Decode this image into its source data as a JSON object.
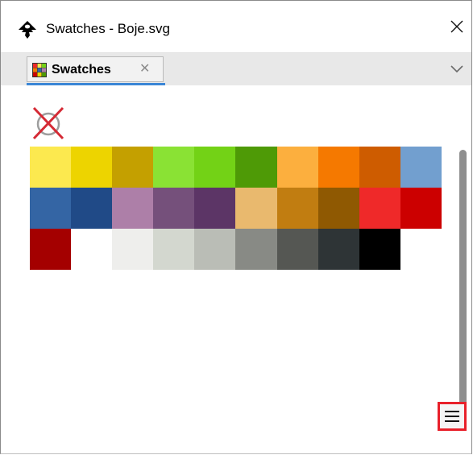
{
  "window": {
    "title": "Swatches - Boje.svg",
    "app_icon": "inkscape-icon",
    "close_icon": "close-icon"
  },
  "tabbar": {
    "tab_label": "Swatches",
    "tab_icon": "swatches-icon",
    "tab_close_label": "✕",
    "menu_icon": "chevron-down-icon",
    "accent_color": "#3b86d6"
  },
  "swatches": {
    "none_icon": "no-paint-icon",
    "colors": [
      "#fce94f",
      "#edd400",
      "#c4a000",
      "#8ae234",
      "#73d216",
      "#4e9a06",
      "#fcaf3e",
      "#f57900",
      "#ce5c00",
      "#729fcf",
      "#3465a4",
      "#204a87",
      "#ad7fa8",
      "#75507b",
      "#5c3566",
      "#e9b96e",
      "#c17d11",
      "#8f5902",
      "#ef2929",
      "#cc0000",
      "#a40000",
      "#ffffff",
      "#eeeeec",
      "#d3d7cf",
      "#babdb6",
      "#888a85",
      "#555753",
      "#2e3436",
      "#000000"
    ]
  },
  "panel": {
    "menu_button_icon": "hamburger-menu-icon",
    "highlight_color": "#e8202a"
  }
}
